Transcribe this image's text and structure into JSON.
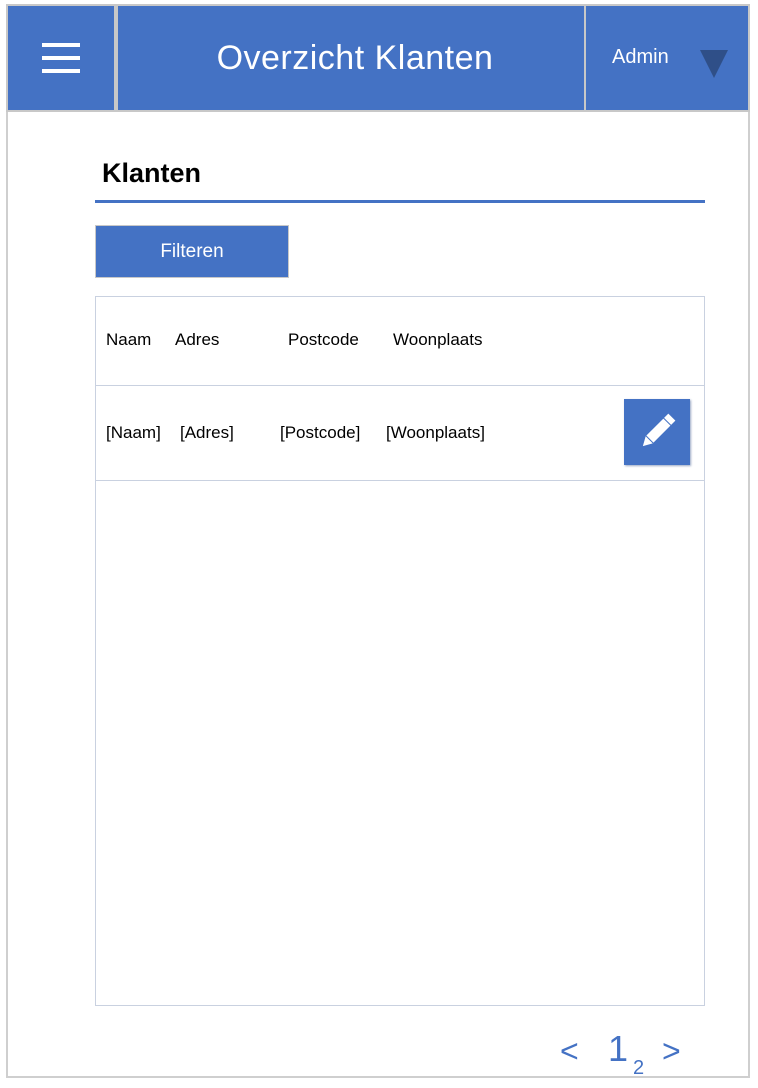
{
  "header": {
    "title": "Overzicht Klanten",
    "user": "Admin",
    "menu_icon": "hamburger-menu-icon",
    "dropdown_icon": "caret-down-icon"
  },
  "section": {
    "title": "Klanten"
  },
  "toolbar": {
    "filter_label": "Filteren"
  },
  "table": {
    "columns": [
      "Naam",
      "Adres",
      "Postcode",
      "Woonplaats"
    ],
    "rows": [
      {
        "naam": "[Naam]",
        "adres": "[Adres]",
        "postcode": "[Postcode]",
        "woonplaats": "[Woonplaats]",
        "action_icon": "pencil-edit-icon"
      }
    ]
  },
  "pagination": {
    "prev": "<",
    "pages": [
      "1",
      "2"
    ],
    "current": "1",
    "next": ">"
  },
  "colors": {
    "accent": "#4472c4",
    "caret": "#2f4f88",
    "border": "#c8c8c8"
  }
}
